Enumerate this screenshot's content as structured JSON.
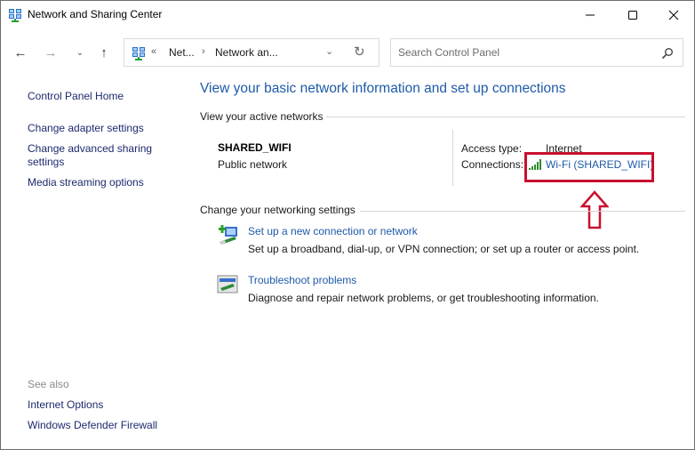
{
  "window": {
    "title": "Network and Sharing Center",
    "controls": {
      "minimize": "minimize",
      "maximize": "maximize",
      "close": "close"
    }
  },
  "navigation": {
    "back_icon": "arrow-left-icon",
    "forward_icon": "arrow-right-icon",
    "recent_icon": "chevron-down-icon",
    "up_icon": "arrow-up-icon",
    "address": {
      "overflow": "«",
      "crumbs": [
        "Net...",
        "Network an..."
      ],
      "separator": "›"
    },
    "search": {
      "placeholder": "Search Control Panel",
      "value": ""
    }
  },
  "sidebar": {
    "home": "Control Panel Home",
    "links": [
      "Change adapter settings",
      "Change advanced sharing",
      "settings",
      "Media streaming options"
    ],
    "see_also_label": "See also",
    "see_also": [
      "Internet Options",
      "Windows Defender Firewall"
    ]
  },
  "main": {
    "title": "View your basic network information and set up connections",
    "active_networks_header": "View your active networks",
    "network": {
      "name": "SHARED_WIFI",
      "category": "Public network",
      "access_type_label": "Access type:",
      "access_type_value": "Internet",
      "connections_label": "Connections:",
      "connection_link": "Wi-Fi (SHARED_WIFI)"
    },
    "change_settings_header": "Change your networking settings",
    "tasks": [
      {
        "link": "Set up a new connection or network",
        "description": "Set up a broadband, dial-up, or VPN connection; or set up a router or access point.",
        "icon": "new-connection-icon"
      },
      {
        "link": "Troubleshoot problems",
        "description": "Diagnose and repair network problems, or get troubleshooting information.",
        "icon": "troubleshoot-icon"
      }
    ]
  },
  "annotation": {
    "highlight_color": "#c8102e"
  },
  "colors": {
    "link": "#1e5aa8",
    "nav_link": "#1c2a6e"
  }
}
